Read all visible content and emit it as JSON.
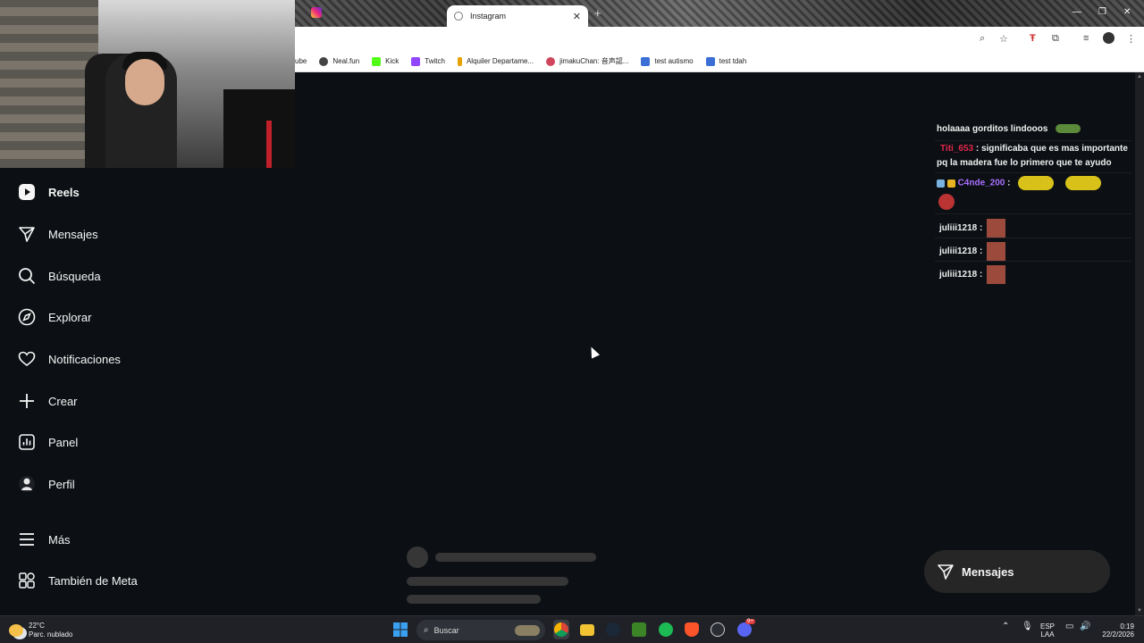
{
  "browser": {
    "active_tab_title": "Instagram",
    "tab_close": "✕",
    "new_tab": "+",
    "window_controls": [
      "—",
      "❐",
      "✕"
    ],
    "bookmarks": [
      {
        "label": "ube",
        "color": "#c4302b"
      },
      {
        "label": "Neal.fun",
        "color": "#444444"
      },
      {
        "label": "Kick",
        "color": "#53fc18"
      },
      {
        "label": "Twitch",
        "color": "#9146ff"
      },
      {
        "label": "Alquiler Departame...",
        "color": "#e8a200"
      },
      {
        "label": "jimakuChan: 音声認...",
        "color": "#d0455b"
      },
      {
        "label": "test autismo",
        "color": "#3b6fd6"
      },
      {
        "label": "test tdah",
        "color": "#3b6fd6"
      }
    ]
  },
  "sidebar": {
    "items": [
      {
        "label": "Reels",
        "icon": "reels-icon"
      },
      {
        "label": "Mensajes",
        "icon": "messages-icon"
      },
      {
        "label": "Búsqueda",
        "icon": "search-icon"
      },
      {
        "label": "Explorar",
        "icon": "explore-icon"
      },
      {
        "label": "Notificaciones",
        "icon": "heart-icon"
      },
      {
        "label": "Crear",
        "icon": "plus-icon"
      },
      {
        "label": "Panel",
        "icon": "dashboard-icon"
      },
      {
        "label": "Perfil",
        "icon": "avatar-icon"
      },
      {
        "label": "Más",
        "icon": "menu-icon"
      },
      {
        "label": "También de Meta",
        "icon": "meta-apps-icon"
      }
    ]
  },
  "chat": {
    "messages": [
      {
        "user": "",
        "text": "holaaaa gorditos lindooos",
        "user_color": "#f0f0f0"
      },
      {
        "user": "Titi_653",
        "text": "significaba que es mas importante pq la madera fue lo primero que te ayudo",
        "user_color": "#e0264b"
      },
      {
        "user": "C4nde_200",
        "text": "",
        "user_color": "#a970ff"
      },
      {
        "user": "juliii1218",
        "text": "",
        "user_color": "#f0f0f0"
      },
      {
        "user": "juliii1218",
        "text": "",
        "user_color": "#f0f0f0"
      },
      {
        "user": "juliii1218",
        "text": "",
        "user_color": "#f0f0f0"
      }
    ],
    "separator": ":"
  },
  "messages_pill": {
    "label": "Mensajes"
  },
  "taskbar": {
    "temperature": "22°C",
    "weather": "Parc. nublado",
    "search_placeholder": "Buscar",
    "lang_top": "ESP",
    "lang_bottom": "LAA",
    "time": "0:19",
    "date": "22/2/2026",
    "discord_badge": "9+"
  }
}
